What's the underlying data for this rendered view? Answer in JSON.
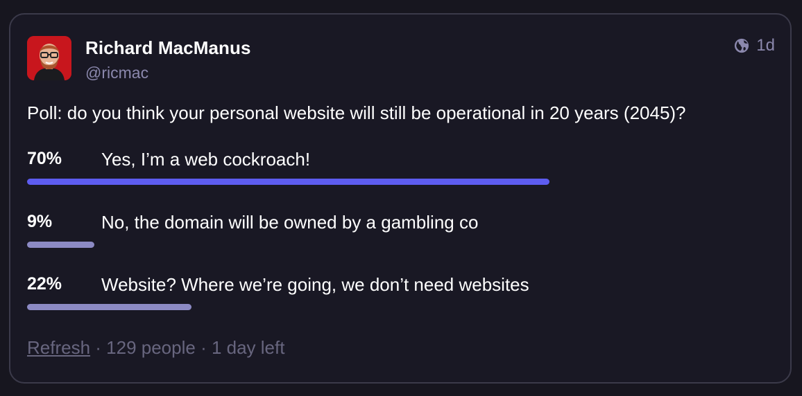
{
  "status": {
    "author": {
      "display_name": "Richard MacManus",
      "handle": "@ricmac",
      "avatar_icon": "avatar-photo"
    },
    "visibility_icon": "globe-icon",
    "relative_time": "1d",
    "text": "Poll: do you think your personal website will still be operational in 20 years (2045)?"
  },
  "poll": {
    "options": [
      {
        "percent_label": "70%",
        "label": "Yes, I’m a web cockroach!",
        "fraction": 0.7,
        "leading": true
      },
      {
        "percent_label": "9%",
        "label": "No, the domain will be owned by a gambling co",
        "fraction": 0.09,
        "leading": false
      },
      {
        "percent_label": "22%",
        "label": "Website? Where we’re going, we don’t need websites",
        "fraction": 0.22,
        "leading": false
      }
    ],
    "refresh_label": "Refresh",
    "separator": " · ",
    "voters": "129 people",
    "time_left": "1 day left"
  },
  "colors": {
    "background": "#17161f",
    "card_border": "#3b3a4a",
    "leading_bar": "#5d5cf0",
    "other_bar": "#8c8ac4",
    "muted_text": "#8b88ad",
    "footer_text": "#68667f"
  }
}
